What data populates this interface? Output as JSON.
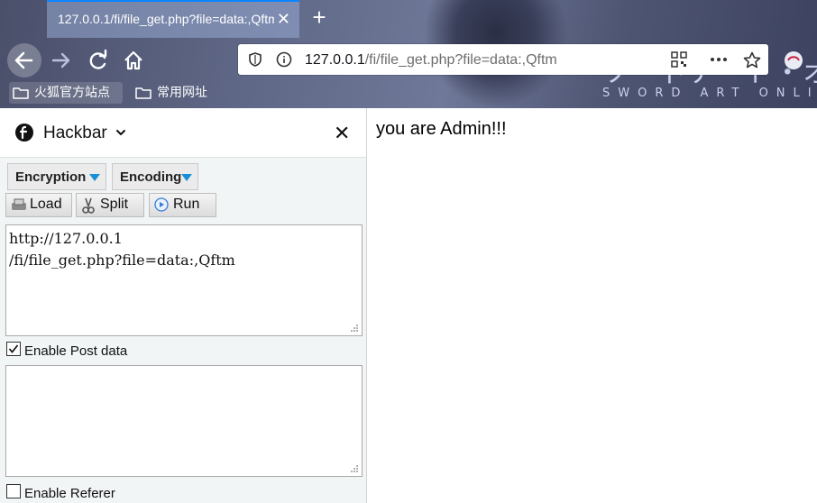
{
  "browser": {
    "tab": {
      "title": "127.0.0.1/fi/file_get.php?file=data:,Qftm",
      "close_symbol": "✕"
    },
    "new_tab_symbol": "+",
    "urlbar": {
      "url_host": "127.0.0.1",
      "url_path": "/fi/file_get.php?file=data:,Qftm"
    },
    "theme_art": {
      "text_jp": "ソードアート・オンライン",
      "text_en": "SWORD ART ONLINE"
    },
    "bookmarks": [
      {
        "label": "火狐官方站点",
        "icon": "folder-icon"
      },
      {
        "label": "常用网址",
        "icon": "folder-icon"
      }
    ]
  },
  "hackbar": {
    "title": "Hackbar",
    "close_symbol": "✕",
    "dropdowns": {
      "encryption": "Encryption",
      "encoding": "Encoding"
    },
    "buttons": {
      "load": "Load",
      "split": "Split",
      "run": "Run"
    },
    "url_value": "http://127.0.0.1\n/fi/file_get.php?file=data:,Qftm",
    "post_data_value": "",
    "enable_post_label": "Enable Post data",
    "enable_post_checked": true,
    "enable_referer_label": "Enable Referer",
    "enable_referer_checked": false
  },
  "page": {
    "message": "you are Admin!!!"
  },
  "colors": {
    "accent": "#0a84ff",
    "dropdown_arrow": "#1a8fd6"
  }
}
